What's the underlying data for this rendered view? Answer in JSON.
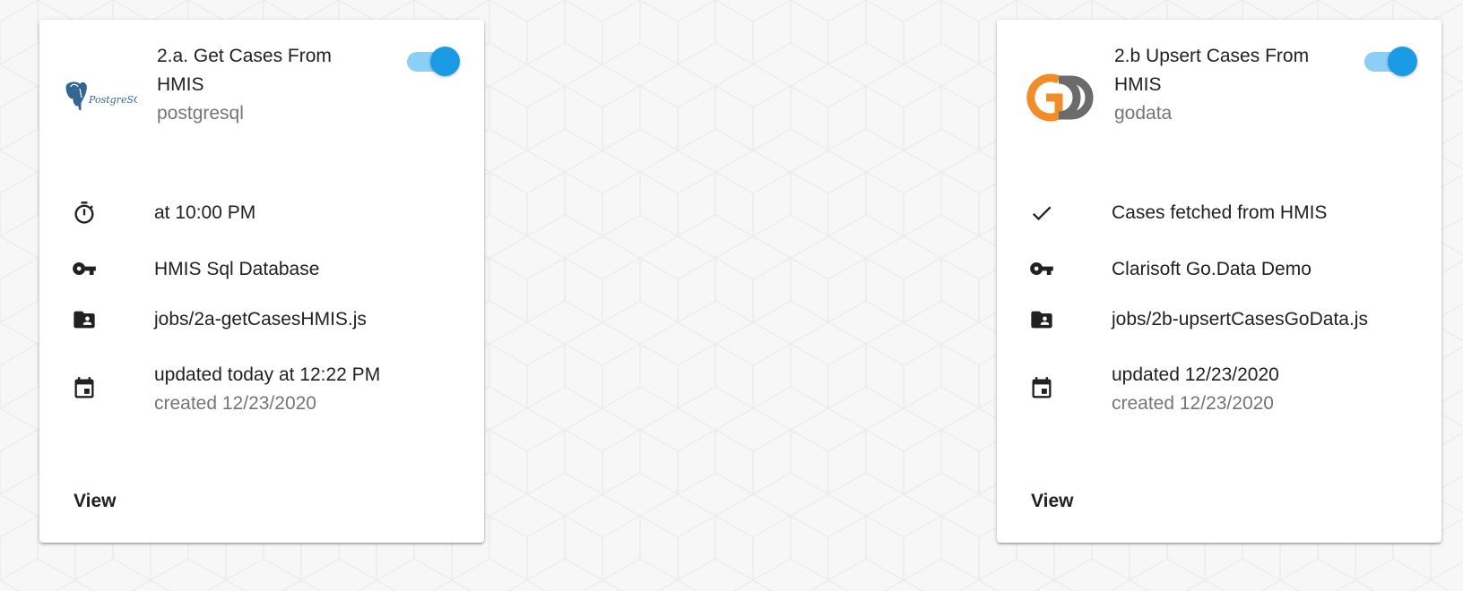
{
  "cards": [
    {
      "title": "2.a. Get Cases From HMIS",
      "adaptor": "postgresql",
      "logo_text": "PostgreSQL",
      "toggle_on": true,
      "trigger": "at 10:00 PM",
      "trigger_icon": "timer-icon",
      "credential": "HMIS Sql Database",
      "credential_icon": "key-icon",
      "path": "jobs/2a-getCasesHMIS.js",
      "path_icon": "folder-shared-icon",
      "updated": "updated today at 12:22 PM",
      "created": "created 12/23/2020",
      "date_icon": "calendar-icon",
      "view_label": "View"
    },
    {
      "title": "2.b Upsert Cases From HMIS",
      "adaptor": "godata",
      "logo_text": "",
      "toggle_on": true,
      "trigger": "Cases fetched from HMIS",
      "trigger_icon": "check-icon",
      "credential": "Clarisoft Go.Data Demo",
      "credential_icon": "key-icon",
      "path": "jobs/2b-upsertCasesGoData.js",
      "path_icon": "folder-shared-icon",
      "updated": "updated 12/23/2020",
      "created": "created 12/23/2020",
      "date_icon": "calendar-icon",
      "view_label": "View"
    }
  ],
  "colors": {
    "toggle_thumb": "#1a9be4",
    "toggle_track": "#8ccff4",
    "godata_orange": "#f28c28",
    "godata_gray": "#6b6b6b",
    "postgres_blue": "#336791"
  }
}
